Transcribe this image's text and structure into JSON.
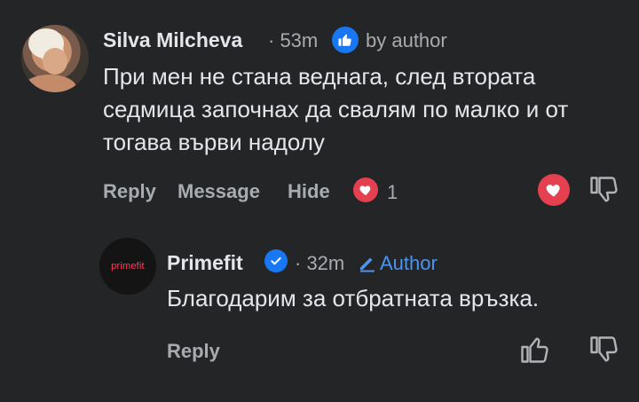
{
  "comment": {
    "author": "Silva Milcheva",
    "time": "· 53m",
    "badge": "by author",
    "text": "При мен не стана веднага, след втората седмица започнах да свалям по малко и от тогава върви надолу",
    "actions": {
      "reply": "Reply",
      "message": "Message",
      "hide": "Hide"
    },
    "likes": "1"
  },
  "reply": {
    "author": "Primefit",
    "time": "· 32m",
    "author_tag": "Author",
    "avatar_logo": "primefit",
    "text": "Благодарим за отбратната връзка.",
    "actions": {
      "reply": "Reply"
    }
  },
  "colors": {
    "background": "#242526",
    "heart": "#e4404f",
    "thumbs_badge": "#1877f2",
    "author_accent": "#4a94f4"
  }
}
